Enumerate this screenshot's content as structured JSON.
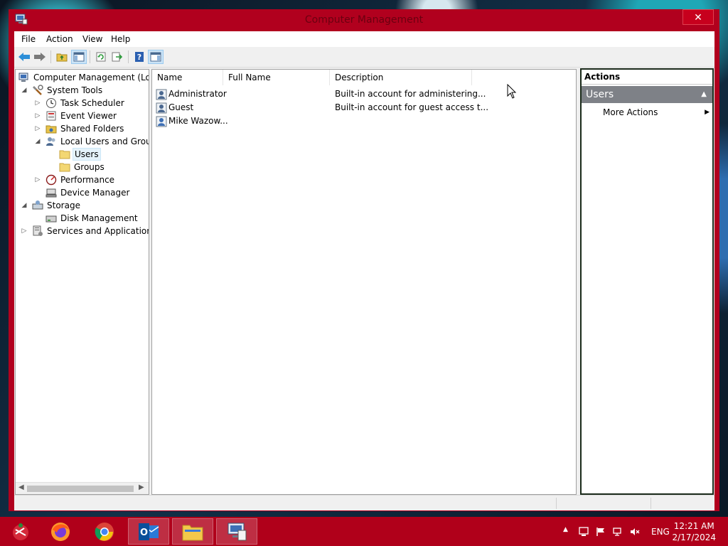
{
  "window": {
    "title": "Computer Management",
    "close_glyph": "✕"
  },
  "menu": [
    "File",
    "Action",
    "View",
    "Help"
  ],
  "toolbar": {
    "buttons": [
      "back-arrow-icon",
      "forward-arrow-icon",
      "up-folder-icon",
      "show-hide-tree-icon",
      "refresh-icon",
      "export-list-icon",
      "help-icon",
      "show-hide-action-pane-icon"
    ]
  },
  "tree": {
    "root": "Computer Management (Local",
    "system_tools": "System Tools",
    "task_scheduler": "Task Scheduler",
    "event_viewer": "Event Viewer",
    "shared_folders": "Shared Folders",
    "local_users_groups": "Local Users and Groups",
    "users": "Users",
    "groups": "Groups",
    "performance": "Performance",
    "device_manager": "Device Manager",
    "storage": "Storage",
    "disk_management": "Disk Management",
    "services_apps": "Services and Applications"
  },
  "list": {
    "columns": [
      "Name",
      "Full Name",
      "Description"
    ],
    "rows": [
      {
        "name": "Administrator",
        "full_name": "",
        "description": "Built-in account for administering..."
      },
      {
        "name": "Guest",
        "full_name": "",
        "description": "Built-in account for guest access t..."
      },
      {
        "name": "Mike Wazow...",
        "full_name": "",
        "description": ""
      }
    ]
  },
  "actions": {
    "header": "Actions",
    "group": "Users",
    "more_actions": "More Actions"
  },
  "taskbar": {
    "apps": [
      "candy-cane-start-icon",
      "firefox-icon",
      "chrome-icon",
      "outlook-icon",
      "file-explorer-icon",
      "computer-management-icon"
    ],
    "language": "ENG",
    "time": "12:21 AM",
    "date": "2/17/2024"
  },
  "colors": {
    "window_frame": "#b1001e",
    "taskbar": "#b0001a",
    "actions_group_bg": "#7e8187"
  }
}
